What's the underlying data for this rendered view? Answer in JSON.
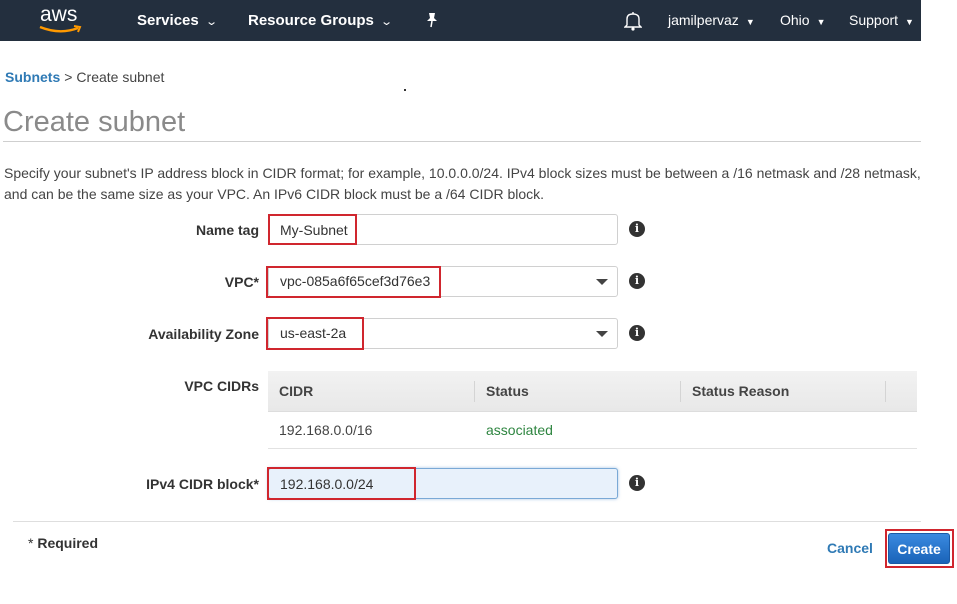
{
  "topnav": {
    "logo_text": "aws",
    "services_label": "Services",
    "resource_groups_label": "Resource Groups",
    "pin_icon": "pin-icon",
    "bell_icon": "bell-icon",
    "user_label": "jamilpervaz",
    "region_label": "Ohio",
    "support_label": "Support"
  },
  "breadcrumb": {
    "parent": "Subnets",
    "separator": ">",
    "current": "Create subnet"
  },
  "page": {
    "title": "Create subnet",
    "description": "Specify your subnet's IP address block in CIDR format; for example, 10.0.0.0/24. IPv4 block sizes must be between a /16 netmask and /28 netmask, and can be the same size as your VPC. An IPv6 CIDR block must be a /64 CIDR block."
  },
  "form": {
    "name_tag": {
      "label": "Name tag",
      "value": "My-Subnet"
    },
    "vpc": {
      "label": "VPC*",
      "value": "vpc-085a6f65cef3d76e3"
    },
    "availability_zone": {
      "label": "Availability Zone",
      "value": "us-east-2a"
    },
    "vpc_cidrs": {
      "label": "VPC CIDRs",
      "columns": [
        "CIDR",
        "Status",
        "Status Reason"
      ],
      "rows": [
        {
          "cidr": "192.168.0.0/16",
          "status": "associated",
          "status_reason": ""
        }
      ]
    },
    "ipv4_cidr_block": {
      "label": "IPv4 CIDR block*",
      "value": "192.168.0.0/24"
    },
    "info_icon": "i"
  },
  "footer": {
    "required_asterisk": "*",
    "required_label": "Required",
    "cancel_label": "Cancel",
    "create_label": "Create"
  },
  "colors": {
    "nav_bg": "#232f3e",
    "link": "#2f7ab5",
    "status_ok": "#2e8540",
    "highlight": "#d0262e",
    "primary_button": "#1a63b8"
  }
}
